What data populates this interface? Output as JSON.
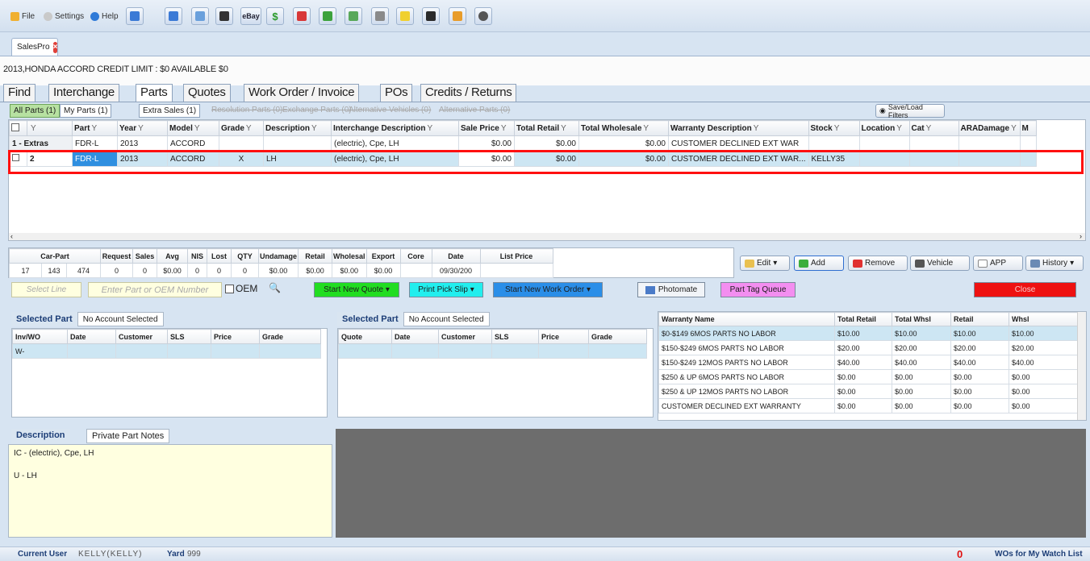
{
  "menu": {
    "file": "File",
    "settings": "Settings",
    "help": "Help"
  },
  "toolbar": {
    "ebay": "eBay"
  },
  "doc_tab": {
    "label": "SalesPro"
  },
  "vehicle_info": "2013,HONDA ACCORD   CREDIT LIMIT : $0  AVAILABLE  $0",
  "main_tabs": [
    "Find",
    "Interchange",
    "Parts",
    "Quotes",
    "Work Order / Invoice",
    "POs",
    "Credits / Returns"
  ],
  "sub_tabs": [
    "All Parts (1)",
    "My Parts (1)",
    "Extra Sales (1)",
    "Resolution Parts (0)",
    "Exchange Parts (0)",
    "Alternative Vehicles (0)",
    "Alternative Parts (0)"
  ],
  "filters_button": "Save/Load Filters",
  "parts_grid": {
    "columns": [
      "Part",
      "Year",
      "Model",
      "Grade",
      "Description",
      "Interchange Description",
      "Sale Price",
      "Total Retail",
      "Total Wholesale",
      "Warranty Description",
      "Stock",
      "Location",
      "Cat",
      "ARADamage",
      "M"
    ],
    "rows": [
      [
        "1 - Extras",
        "FDR-L",
        "2013",
        "ACCORD",
        "",
        "",
        "(electric), Cpe, LH",
        "$0.00",
        "$0.00",
        "$0.00",
        "CUSTOMER DECLINED EXT WAR",
        "",
        "",
        "",
        "",
        ""
      ],
      [
        "2",
        "FDR-L",
        "2013",
        "ACCORD",
        "X",
        "LH",
        "(electric), Cpe, LH",
        "$0.00",
        "$0.00",
        "$0.00",
        "CUSTOMER DECLINED EXT WAR...",
        "KELLY35",
        "",
        "",
        "",
        ""
      ]
    ]
  },
  "stats": {
    "headers": [
      "Car-Part",
      "",
      "Request",
      "Sales",
      "Avg",
      "NIS",
      "Lost",
      "QTY",
      "Undamage",
      "Retail",
      "Wholesal",
      "Export",
      "Core",
      "Date",
      "List Price"
    ],
    "values": [
      "17",
      "143",
      "474",
      "0",
      "0",
      "$0.00",
      "0",
      "0",
      "0",
      "$0.00",
      "$0.00",
      "$0.00",
      "$0.00",
      "",
      "09/30/200",
      ""
    ]
  },
  "right_buttons": {
    "edit": "Edit",
    "add": "Add",
    "remove": "Remove",
    "vehicle": "Vehicle",
    "app": "APP",
    "history": "History"
  },
  "actions": {
    "select_line": "Select Line",
    "part_placeholder": "Enter Part or OEM Number",
    "oem": "OEM",
    "start_quote": "Start New Quote",
    "print_pick": "Print Pick Slip",
    "start_work_order": "Start New Work Order",
    "photomate": "Photomate",
    "part_tag_queue": "Part Tag Queue",
    "close": "Close"
  },
  "left_panel": {
    "title": "Selected Part",
    "account": "No Account Selected",
    "headers": [
      "Inv/WO",
      "Date",
      "Customer",
      "SLS",
      "Price",
      "Grade"
    ],
    "row": [
      "W-",
      "",
      "",
      "",
      "",
      ""
    ]
  },
  "mid_panel": {
    "title": "Selected Part",
    "account": "No Account Selected",
    "headers": [
      "Quote",
      "Date",
      "Customer",
      "SLS",
      "Price",
      "Grade"
    ]
  },
  "warranty": {
    "headers": [
      "Warranty Name",
      "Total Retail",
      "Total Whsl",
      "Retail",
      "Whsl"
    ],
    "rows": [
      [
        "$0-$149 6MOS PARTS NO LABOR",
        "$10.00",
        "$10.00",
        "$10.00",
        "$10.00"
      ],
      [
        "$150-$249 6MOS PARTS NO LABOR",
        "$20.00",
        "$20.00",
        "$20.00",
        "$20.00"
      ],
      [
        "$150-$249 12MOS PARTS NO LABOR",
        "$40.00",
        "$40.00",
        "$40.00",
        "$40.00"
      ],
      [
        "$250 & UP 6MOS PARTS NO LABOR",
        "$0.00",
        "$0.00",
        "$0.00",
        "$0.00"
      ],
      [
        "$250 & UP 12MOS PARTS NO LABOR",
        "$0.00",
        "$0.00",
        "$0.00",
        "$0.00"
      ],
      [
        "CUSTOMER DECLINED EXT WARRANTY",
        "$0.00",
        "$0.00",
        "$0.00",
        "$0.00"
      ]
    ]
  },
  "description": {
    "tabs": [
      "Description",
      "Private Part Notes"
    ],
    "lines": [
      "IC - (electric), Cpe, LH",
      "U - LH"
    ]
  },
  "status_bar": {
    "user_label": "Current User",
    "user": "KELLY(KELLY)",
    "yard_label": "Yard",
    "yard": "999",
    "watch_count": "0",
    "watch_label": "WOs for My Watch List"
  },
  "colors": {
    "highlight": "#ff1010",
    "selection": "#cde6f3",
    "part_selected": "#2f8fe0",
    "close_button": "#ee1111",
    "quote_button": "#22dd22",
    "print_button": "#22eeee",
    "work_order_button": "#2a8ee8",
    "tag_queue_button": "#f38ef0"
  }
}
